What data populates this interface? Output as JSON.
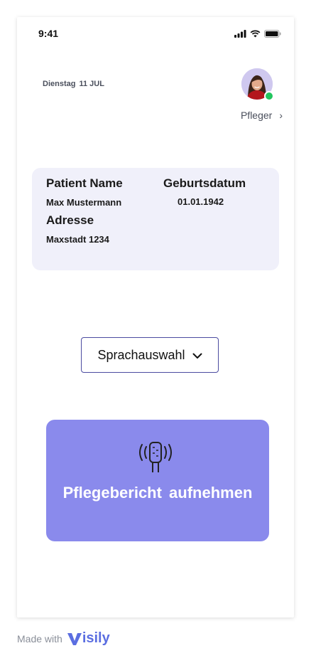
{
  "status_bar": {
    "time": "9:41",
    "icons": [
      "signal-icon",
      "wifi-icon",
      "battery-icon"
    ]
  },
  "header": {
    "weekday": "Dienstag",
    "date": "11 JUL",
    "role": "Pfleger",
    "role_chevron": "›"
  },
  "patient_card": {
    "name_label": "Patient Name",
    "name_value": "Max Mustermann",
    "birth_label": "Geburtsdatum",
    "birth_value": "01.01.1942",
    "address_label": "Adresse",
    "address_value": "Maxstadt 1234"
  },
  "language_select": {
    "label": "Sprachauswahl"
  },
  "record": {
    "label": "Pflegebericht aufnehmen",
    "icon": "microphone-icon"
  },
  "footer": {
    "made_with": "Made with",
    "brand_rest": "isily"
  },
  "colors": {
    "accent": "#8a8aec",
    "card_bg": "#f0f0fa",
    "select_border": "#4b4ba0",
    "online": "#22c55e",
    "brand": "#5b6ee1"
  }
}
